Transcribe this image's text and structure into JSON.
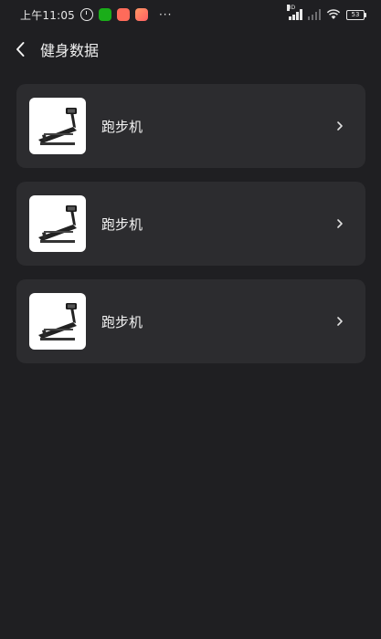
{
  "status_bar": {
    "time": "上午11:05",
    "overflow": "···",
    "battery": "53",
    "network_label": "HD"
  },
  "header": {
    "title": "健身数据"
  },
  "items": [
    {
      "label": "跑步机"
    },
    {
      "label": "跑步机"
    },
    {
      "label": "跑步机"
    }
  ]
}
